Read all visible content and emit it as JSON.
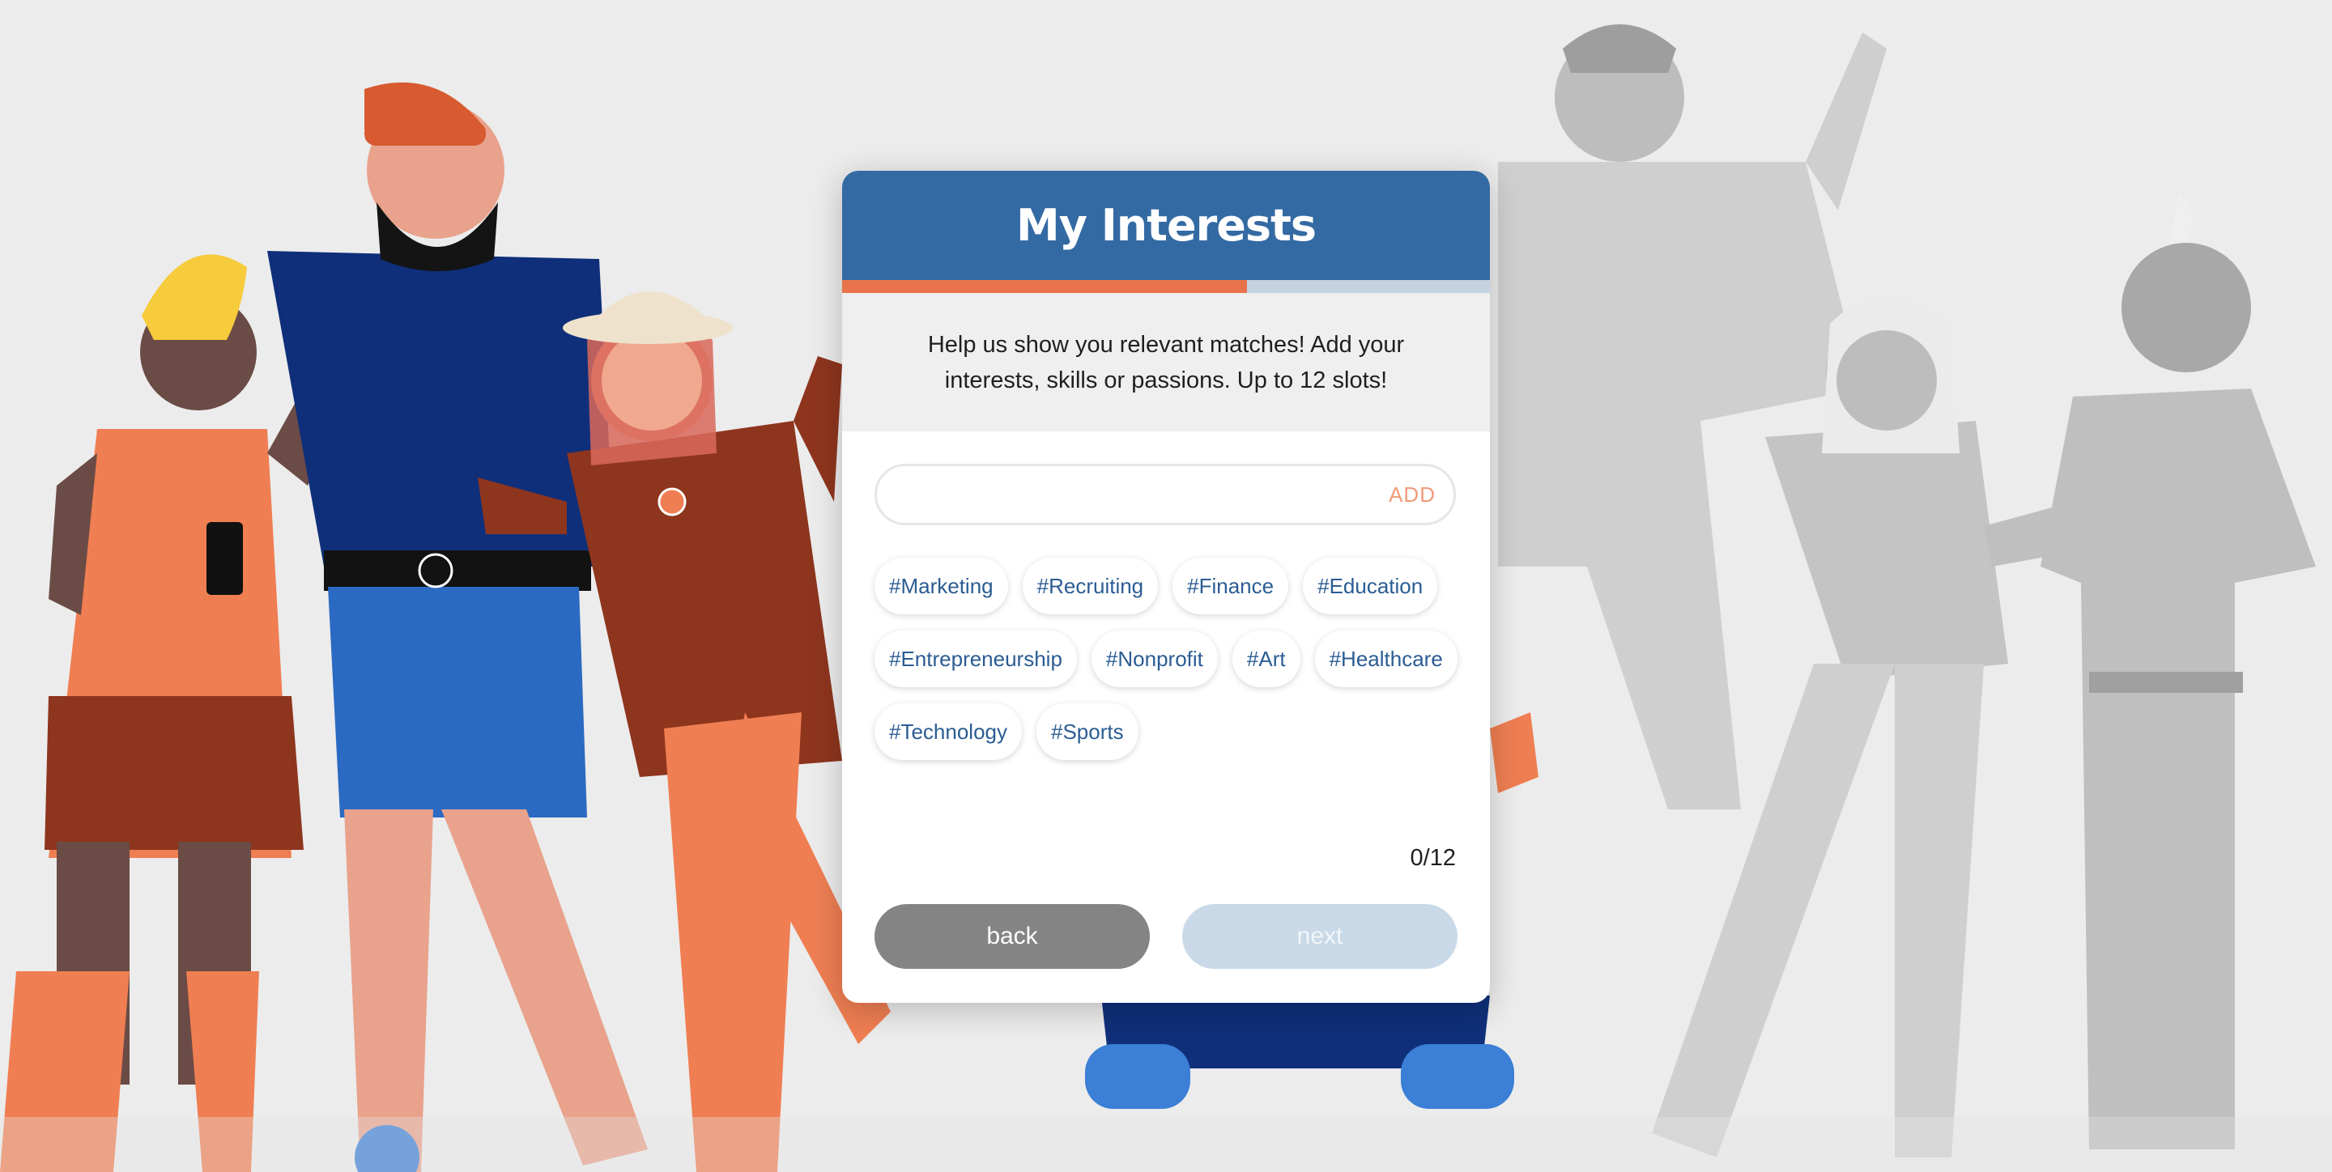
{
  "modal": {
    "title": "My Interests",
    "progress_fraction": 0.625,
    "intro": "Help us show you relevant matches! Add your interests, skills or passions. Up to 12 slots!",
    "input": {
      "value": "",
      "placeholder": ""
    },
    "add_label": "ADD",
    "tags": [
      "#Marketing",
      "#Recruiting",
      "#Finance",
      "#Education",
      "#Entrepreneurship",
      "#Nonprofit",
      "#Art",
      "#Healthcare",
      "#Technology",
      "#Sports"
    ],
    "counter": "0/12",
    "back_label": "back",
    "next_label": "next"
  },
  "colors": {
    "header": "#346aa3",
    "progress": "#e8734a",
    "tag_text": "#2b5c93",
    "back_button": "#848484",
    "next_button_disabled": "#c9d9e8"
  },
  "illustration": {
    "description_icons": [
      "people-illustration-left",
      "people-illustration-right"
    ]
  }
}
